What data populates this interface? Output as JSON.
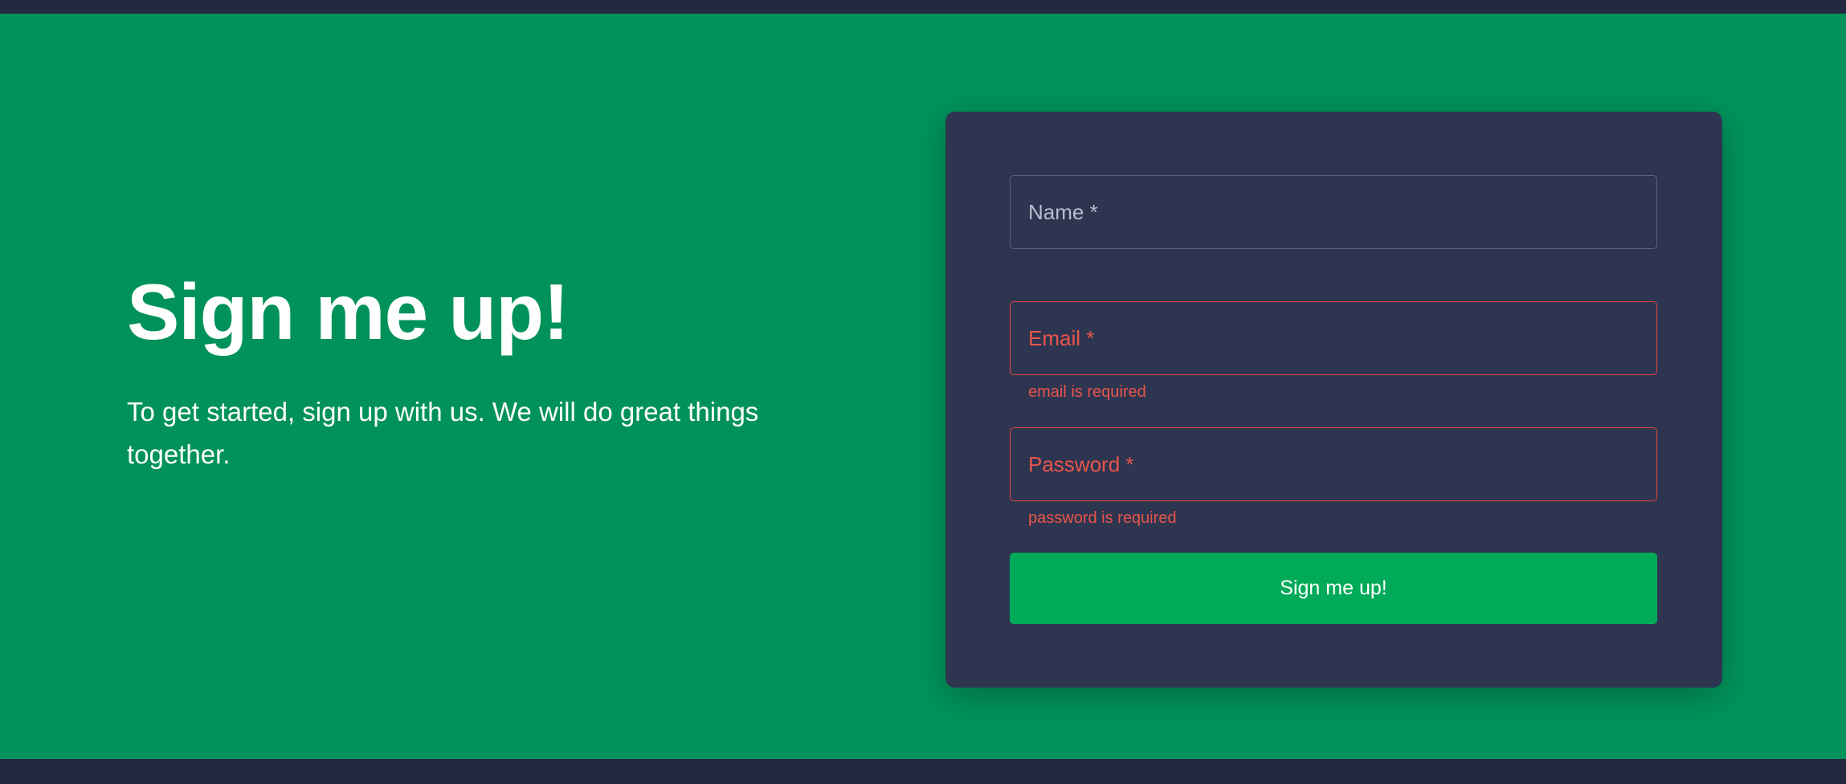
{
  "hero": {
    "title": "Sign me up!",
    "subtitle": "To get started, sign up with us. We will do great things together."
  },
  "form": {
    "name": {
      "placeholder": "Name *"
    },
    "email": {
      "placeholder": "Email *",
      "error": "email is required"
    },
    "password": {
      "placeholder": "Password *",
      "error": "password is required"
    },
    "submit_label": "Sign me up!"
  },
  "colors": {
    "hero_background": "#00925a",
    "page_background": "#21283f",
    "card_background": "#2e3551",
    "error": "#e8554a",
    "button": "#00aa58"
  }
}
